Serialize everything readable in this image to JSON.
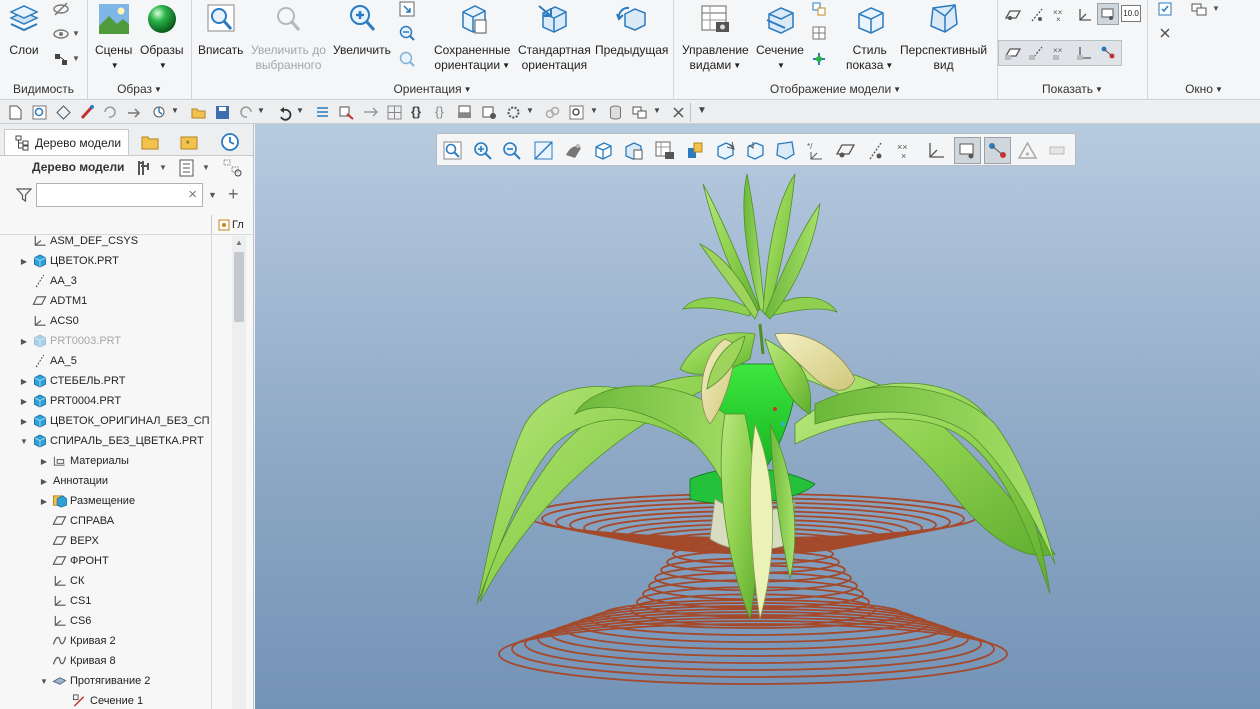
{
  "ribbon": {
    "visibility": {
      "label": "Видимость",
      "layers": "Слои"
    },
    "appearance": {
      "label": "Образ",
      "scenes": "Сцены",
      "appearances": "Образы"
    },
    "orientation": {
      "label": "Ориентация",
      "fit": "Вписать",
      "zoom_selected_1": "Увеличить до",
      "zoom_selected_2": "выбранного",
      "zoom_in": "Увеличить",
      "saved_1": "Сохраненные",
      "saved_2": "ориентации",
      "standard_1": "Стандартная",
      "standard_2": "ориентация",
      "previous": "Предыдущая"
    },
    "model_display": {
      "label": "Отображение модели",
      "manage_1": "Управление",
      "manage_2": "видами",
      "section": "Сечение",
      "style_1": "Стиль",
      "style_2": "показа",
      "perspective_1": "Перспективный",
      "perspective_2": "вид"
    },
    "show": {
      "label": "Показать",
      "badge": "10.0"
    },
    "window": {
      "label": "Окно"
    }
  },
  "panel": {
    "tab_tree": "Дерево модели",
    "tree_title": "Дерево модели",
    "search_value": "",
    "search_clear": "×",
    "column_header": "Гл",
    "rows": [
      {
        "label": "ASM_DEF_CSYS",
        "icon": "csys-icon",
        "arrow": "",
        "indent": 0,
        "dim": false
      },
      {
        "label": "ЦВЕТОК.PRT",
        "icon": "part-icon",
        "arrow": "▶",
        "indent": 0,
        "dim": false
      },
      {
        "label": "AA_3",
        "icon": "axis-icon",
        "arrow": "",
        "indent": 0,
        "dim": false
      },
      {
        "label": "ADTM1",
        "icon": "datum-plane-icon",
        "arrow": "",
        "indent": 0,
        "dim": false
      },
      {
        "label": "ACS0",
        "icon": "csys-icon",
        "arrow": "",
        "indent": 0,
        "dim": false
      },
      {
        "label": "PRT0003.PRT",
        "icon": "part-icon",
        "arrow": "▶",
        "indent": 0,
        "dim": true
      },
      {
        "label": "AA_5",
        "icon": "axis-icon",
        "arrow": "",
        "indent": 0,
        "dim": false
      },
      {
        "label": "СТЕБЕЛЬ.PRT",
        "icon": "part-icon",
        "arrow": "▶",
        "indent": 0,
        "dim": false
      },
      {
        "label": "PRT0004.PRT",
        "icon": "part-icon",
        "arrow": "▶",
        "indent": 0,
        "dim": false
      },
      {
        "label": "ЦВЕТОК_ОРИГИНАЛ_БЕЗ_СП",
        "icon": "part-icon",
        "arrow": "▶",
        "indent": 0,
        "dim": false
      },
      {
        "label": "СПИРАЛЬ_БЕЗ_ЦВЕТКА.PRT",
        "icon": "part-icon",
        "arrow": "▼",
        "indent": 0,
        "dim": false
      },
      {
        "label": "Материалы",
        "icon": "materials-icon",
        "arrow": "▶",
        "indent": 1,
        "dim": false
      },
      {
        "label": "Аннотации",
        "icon": "",
        "arrow": "▶",
        "indent": 1,
        "dim": false
      },
      {
        "label": "Размещение",
        "icon": "placement-icon",
        "arrow": "▶",
        "indent": 1,
        "dim": false
      },
      {
        "label": "СПРАВА",
        "icon": "datum-plane-icon",
        "arrow": "",
        "indent": 1,
        "dim": false
      },
      {
        "label": "ВЕРХ",
        "icon": "datum-plane-icon",
        "arrow": "",
        "indent": 1,
        "dim": false
      },
      {
        "label": "ФРОНТ",
        "icon": "datum-plane-icon",
        "arrow": "",
        "indent": 1,
        "dim": false
      },
      {
        "label": "СК",
        "icon": "csys-icon",
        "arrow": "",
        "indent": 1,
        "dim": false
      },
      {
        "label": "CS1",
        "icon": "csys-icon",
        "arrow": "",
        "indent": 1,
        "dim": false
      },
      {
        "label": "CS6",
        "icon": "csys-icon",
        "arrow": "",
        "indent": 1,
        "dim": false
      },
      {
        "label": "Кривая 2",
        "icon": "curve-icon",
        "arrow": "",
        "indent": 1,
        "dim": false
      },
      {
        "label": "Кривая 8",
        "icon": "curve-icon",
        "arrow": "",
        "indent": 1,
        "dim": false
      },
      {
        "label": "Протягивание 2",
        "icon": "sweep-icon",
        "arrow": "▼",
        "indent": 1,
        "dim": false
      },
      {
        "label": "Сечение 1",
        "icon": "sketch-icon",
        "arrow": "",
        "indent": 2,
        "dim": false
      }
    ]
  },
  "colors": {
    "viewport_top": "#b7cbe0",
    "viewport_bottom": "#7393b6",
    "leaf_green": "#8fd14f",
    "petal_yellow": "#e8e2a0",
    "spiral_copper": "#a4492a",
    "part_blue": "#2f9fd8"
  }
}
